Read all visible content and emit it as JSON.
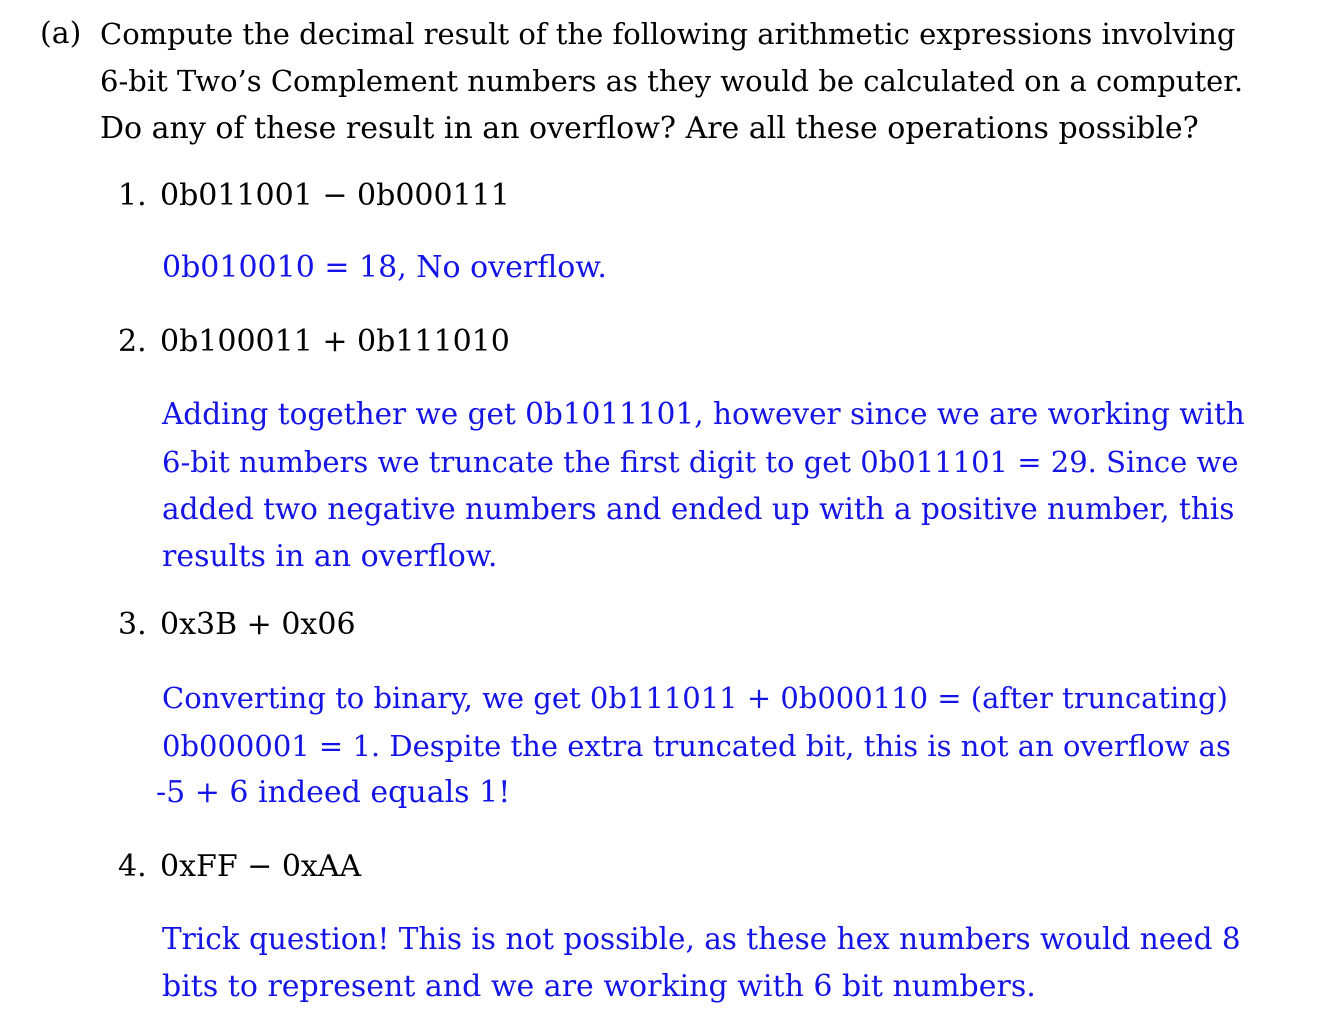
{
  "question": {
    "label": "(a)",
    "lines": [
      "Compute the decimal result of the following arithmetic expressions involving",
      "6-bit Two’s Complement numbers as they would be calculated on a computer.",
      "Do any of these result in an overflow? Are all these operations possible?"
    ]
  },
  "items": [
    {
      "number": "1.",
      "expression": "0b011001 − 0b000111",
      "answer_lines": [
        "0b010010 = 18, No overflow."
      ]
    },
    {
      "number": "2.",
      "expression": "0b100011 + 0b111010",
      "answer_lines": [
        "Adding together we get 0b1011101, however since we are working with",
        "6-bit numbers we truncate the first digit to get 0b011101 = 29. Since we",
        "added two negative numbers and ended up with a positive number, this",
        "results in an overflow."
      ]
    },
    {
      "number": "3.",
      "expression": "0x3B + 0x06",
      "answer_lines": [
        "Converting to binary, we get 0b111011 + 0b000110 = (after truncating)",
        "0b000001 = 1. Despite the extra truncated bit, this is not an overflow as",
        "-5 + 6 indeed equals 1!"
      ]
    },
    {
      "number": "4.",
      "expression": "0xFF − 0xAA",
      "answer_lines": [
        "Trick question! This is not possible, as these hex numbers would need 8",
        "bits to represent and we are working with 6 bit numbers."
      ]
    }
  ],
  "colors": {
    "text": "#000000",
    "answer": "#1414e6",
    "background": "#ffffff"
  }
}
